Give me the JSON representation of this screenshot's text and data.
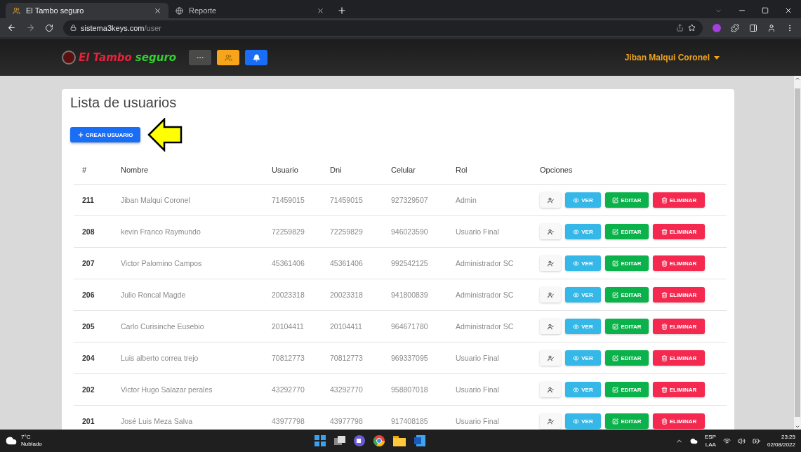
{
  "browser": {
    "tabs": [
      {
        "title": "El Tambo seguro",
        "selected": true
      },
      {
        "title": "Reporte",
        "selected": false
      }
    ],
    "url": {
      "domain": "sistema3keys.com",
      "path": "/user"
    }
  },
  "navbar": {
    "brand": {
      "first": "El Tambo",
      "second": "seguro"
    },
    "user": "Jiban Malqui Coronel"
  },
  "page": {
    "title": "Lista de usuarios",
    "create_button": "CREAR USUARIO"
  },
  "table": {
    "columns": [
      "#",
      "Nombre",
      "Usuario",
      "Dni",
      "Celular",
      "Rol",
      "Opciones"
    ],
    "rows": [
      {
        "id": "211",
        "name": "Jiban Malqui Coronel",
        "user": "71459015",
        "dni": "71459015",
        "phone": "927329507",
        "role": "Admin",
        "actions": [
          {
            "kind": "profile"
          },
          {
            "kind": "view",
            "label": "VER"
          },
          {
            "kind": "edit",
            "label": "EDITAR"
          },
          {
            "kind": "delete",
            "label": "ELIMINAR"
          }
        ]
      },
      {
        "id": "208",
        "name": "kevin Franco Raymundo",
        "user": "72259829",
        "dni": "72259829",
        "phone": "946023590",
        "role": "Usuario Final",
        "actions": [
          {
            "kind": "profile"
          },
          {
            "kind": "view",
            "label": "VER"
          },
          {
            "kind": "edit",
            "label": "EDITAR"
          },
          {
            "kind": "delete",
            "label": "ELIMINAR"
          }
        ]
      },
      {
        "id": "207",
        "name": "Victor Palomino Campos",
        "user": "45361406",
        "dni": "45361406",
        "phone": "992542125",
        "role": "Administrador SC",
        "actions": [
          {
            "kind": "profile"
          },
          {
            "kind": "view",
            "label": "VER"
          },
          {
            "kind": "edit",
            "label": "EDITAR"
          },
          {
            "kind": "delete",
            "label": "ELIMINAR"
          }
        ]
      },
      {
        "id": "206",
        "name": "Julio Roncal Magde",
        "user": "20023318",
        "dni": "20023318",
        "phone": "941800839",
        "role": "Administrador SC",
        "actions": [
          {
            "kind": "profile"
          },
          {
            "kind": "view",
            "label": "VER"
          },
          {
            "kind": "edit",
            "label": "EDITAR"
          },
          {
            "kind": "delete",
            "label": "ELIMINAR"
          }
        ]
      },
      {
        "id": "205",
        "name": "Carlo Curisinche Eusebio",
        "user": "20104411",
        "dni": "20104411",
        "phone": "964671780",
        "role": "Administrador SC",
        "actions": [
          {
            "kind": "profile"
          },
          {
            "kind": "view",
            "label": "VER"
          },
          {
            "kind": "edit",
            "label": "EDITAR"
          },
          {
            "kind": "delete",
            "label": "ELIMINAR"
          }
        ]
      },
      {
        "id": "204",
        "name": "Luis alberto correa trejo",
        "user": "70812773",
        "dni": "70812773",
        "phone": "969337095",
        "role": "Usuario Final",
        "actions": [
          {
            "kind": "profile"
          },
          {
            "kind": "view",
            "label": "VER"
          },
          {
            "kind": "edit",
            "label": "EDITAR"
          },
          {
            "kind": "delete",
            "label": "ELIMINAR"
          }
        ]
      },
      {
        "id": "202",
        "name": "Victor Hugo Salazar perales",
        "user": "43292770",
        "dni": "43292770",
        "phone": "958807018",
        "role": "Usuario Final",
        "actions": [
          {
            "kind": "profile"
          },
          {
            "kind": "view",
            "label": "VER"
          },
          {
            "kind": "edit",
            "label": "EDITAR"
          },
          {
            "kind": "delete",
            "label": "ELIMINAR"
          }
        ]
      },
      {
        "id": "201",
        "name": "José Luis Meza Salva",
        "user": "43977798",
        "dni": "43977798",
        "phone": "917408185",
        "role": "Usuario Final",
        "actions": [
          {
            "kind": "profile"
          },
          {
            "kind": "view",
            "label": "VER"
          },
          {
            "kind": "edit",
            "label": "EDITAR"
          },
          {
            "kind": "delete",
            "label": "ELIMINAR"
          }
        ]
      }
    ]
  },
  "taskbar": {
    "weather": {
      "temp": "7°C",
      "condition": "Nublado"
    },
    "language": {
      "code": "ESP",
      "layout": "LAA"
    },
    "time": "23:25",
    "date": "02/08/2022"
  }
}
